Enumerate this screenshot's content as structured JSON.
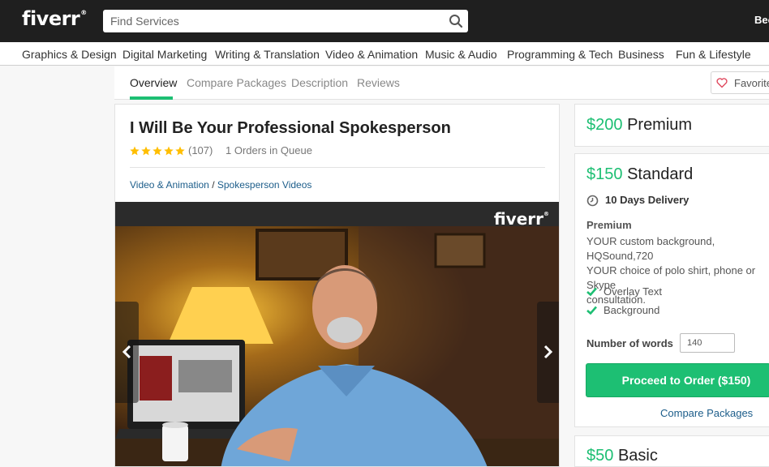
{
  "header": {
    "logo": "fiverr",
    "logo_mark": "®",
    "search_placeholder": "Find Services",
    "search_icon": "search-icon",
    "user_label": "Bec"
  },
  "categories": [
    "Graphics & Design",
    "Digital Marketing",
    "Writing & Translation",
    "Video & Animation",
    "Music & Audio",
    "Programming & Tech",
    "Business",
    "Fun & Lifestyle"
  ],
  "subnav": {
    "tabs": [
      "Overview",
      "Compare Packages",
      "Description",
      "Reviews"
    ],
    "active_tab": "Overview",
    "favorite_label": "Favorite",
    "favorite_icon": "heart-icon"
  },
  "gig": {
    "title": "I Will Be Your Professional Spokesperson",
    "rating_stars": 5,
    "rating_count": "(107)",
    "queue": "1 Orders in Queue",
    "breadcrumb": {
      "category": "Video & Animation",
      "separator": " / ",
      "subcategory": "Spokesperson Videos"
    },
    "video": {
      "watermark": "fiverr",
      "watermark_mark": "®",
      "prev_icon": "chevron-left-icon",
      "next_icon": "chevron-right-icon"
    }
  },
  "packages": {
    "premium": {
      "price": "$200",
      "name": "Premium"
    },
    "standard": {
      "price": "$150",
      "name": "Standard",
      "delivery": "10 Days Delivery",
      "delivery_icon": "clock-icon",
      "package_title": "Premium",
      "description": "YOUR custom background, HQSound,720\nYOUR choice of polo shirt, phone or Skype\nconsultation.",
      "features": [
        "Overlay Text",
        "Background"
      ],
      "feature_icon": "check-icon",
      "words_label": "Number of words",
      "words_value": "140",
      "order_button": "Proceed to Order ($150)",
      "compare_link": "Compare Packages"
    },
    "basic": {
      "price": "$50",
      "name": "Basic"
    }
  },
  "colors": {
    "brand_green": "#1dbf73",
    "link_blue": "#1c5d8a",
    "star_yellow": "#ffbe00",
    "topbar": "#1f1f1f"
  }
}
